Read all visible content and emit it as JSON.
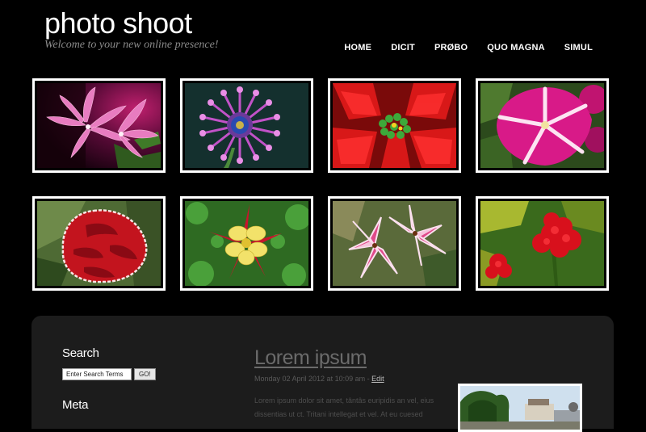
{
  "header": {
    "site_title": "photo shoot",
    "tagline": "Welcome to your new online presence!"
  },
  "nav": {
    "items": [
      "HOME",
      "DICIT",
      "PRØBO",
      "QUO MAGNA",
      "SIMUL"
    ]
  },
  "gallery": {
    "photos": [
      {
        "name": "pink-orchid-photo"
      },
      {
        "name": "purple-daisy-photo"
      },
      {
        "name": "red-poinsettia-photo"
      },
      {
        "name": "pink-petunia-photo"
      },
      {
        "name": "red-carnation-photo"
      },
      {
        "name": "yellow-columbine-photo"
      },
      {
        "name": "pink-lily-photo"
      },
      {
        "name": "red-geranium-photo"
      }
    ]
  },
  "sidebar": {
    "search_heading": "Search",
    "search_value": "Enter Search Terms",
    "search_button": "GO!",
    "meta_heading": "Meta"
  },
  "post": {
    "title": "Lorem ipsum",
    "date": "Monday 02 April 2012 at 10:09 am - ",
    "edit_label": "Edit",
    "excerpt": "Lorem ipsum dolor sit amet, tântâs euripidis an vel, eius dissentias ut ct. Tritani intellegat et vel. At eu cuesed"
  },
  "colors": {
    "background": "#000000",
    "panel": "#1c1c1c",
    "tagline": "#8a8a8a",
    "post_title": "#6b6b6b"
  }
}
